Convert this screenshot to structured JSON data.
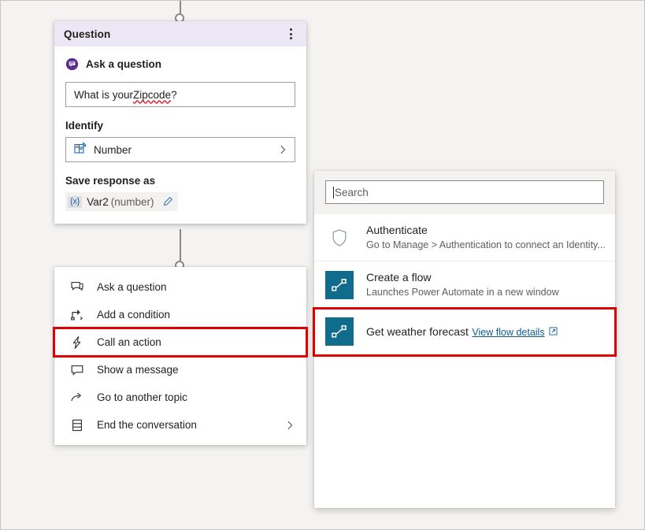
{
  "node": {
    "title": "Question",
    "more_icon": "more-vertical-icon",
    "ask": {
      "icon": "ask-question-icon",
      "label": "Ask a question",
      "question_value": "What is your ",
      "question_misspelled": "Zipcode",
      "question_suffix": "?"
    },
    "identify": {
      "label": "Identify",
      "icon": "entity-grid-icon",
      "value": "Number",
      "chevron": "chevron-right-icon"
    },
    "save_response": {
      "label": "Save response as",
      "badge": "{x}",
      "variable": "Var2",
      "type": "(number)",
      "edit_icon": "pencil-icon"
    }
  },
  "menu": {
    "items": [
      {
        "label": "Ask a question",
        "icon": "ask-question-icon",
        "highlighted": false,
        "chevron": false
      },
      {
        "label": "Add a condition",
        "icon": "condition-icon",
        "highlighted": false,
        "chevron": false
      },
      {
        "label": "Call an action",
        "icon": "lightning-bolt-icon",
        "highlighted": true,
        "chevron": false
      },
      {
        "label": "Show a message",
        "icon": "message-icon",
        "highlighted": false,
        "chevron": false
      },
      {
        "label": "Go to another topic",
        "icon": "redirect-arrow-icon",
        "highlighted": false,
        "chevron": false
      },
      {
        "label": "End the conversation",
        "icon": "end-list-icon",
        "highlighted": false,
        "chevron": true
      }
    ]
  },
  "flyout": {
    "search": {
      "placeholder": "Search",
      "value": ""
    },
    "items": [
      {
        "title": "Authenticate",
        "subtitle": "Go to Manage > Authentication to connect an Identity...",
        "icon": "shield-icon",
        "icon_style": "outline",
        "highlighted": false,
        "link": null
      },
      {
        "title": "Create a flow",
        "subtitle": "Launches Power Automate in a new window",
        "icon": "flow-icon",
        "icon_style": "tile",
        "highlighted": false,
        "link": null
      },
      {
        "title": "Get weather forecast",
        "subtitle": null,
        "icon": "flow-icon",
        "icon_style": "tile",
        "highlighted": true,
        "link": {
          "label": "View flow details",
          "icon": "open-in-new-icon"
        }
      }
    ]
  },
  "colors": {
    "canvas": "#f4f3f2",
    "node_header": "#ebe7f4",
    "accent_purple": "#5c2d91",
    "highlight_red": "#e00000",
    "flow_teal": "#0f6c8c",
    "link_blue": "#0f5a8f",
    "connector_gray": "#8a8886"
  }
}
